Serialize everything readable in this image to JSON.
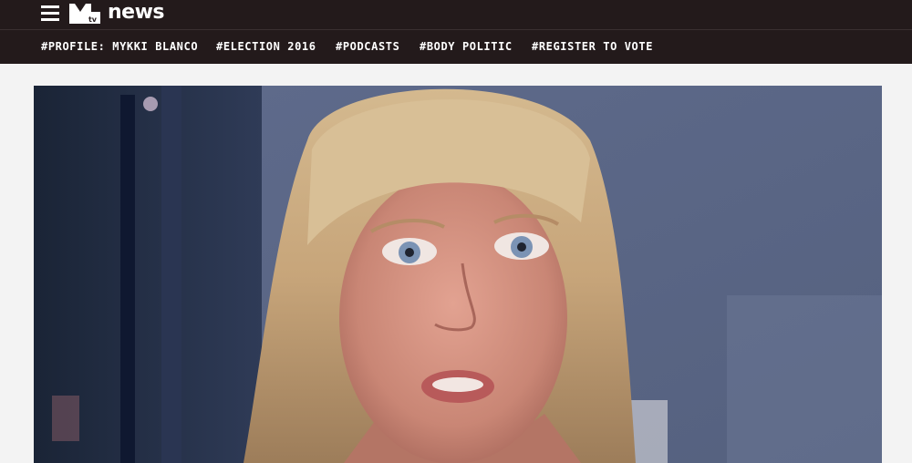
{
  "header": {
    "brand_text": "news",
    "logo_icon": "mtv-logo-icon",
    "menu_icon": "hamburger-menu-icon",
    "background": "#231a1b"
  },
  "nav": {
    "items": [
      {
        "label": "#PROFILE: MYKKI BLANCO"
      },
      {
        "label": "#ELECTION 2016"
      },
      {
        "label": "#PODCASTS"
      },
      {
        "label": "#BODY POLITIC"
      },
      {
        "label": "#REGISTER TO VOTE"
      }
    ]
  },
  "hero": {
    "kind": "article-hero-image",
    "subject": "portrait-photo"
  }
}
